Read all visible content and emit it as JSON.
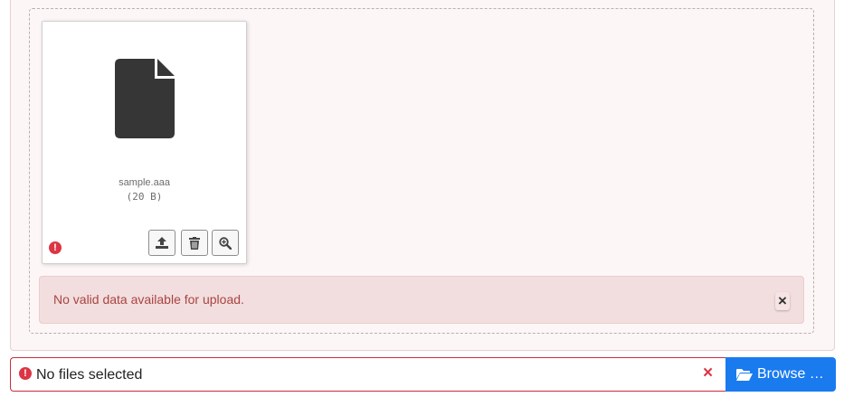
{
  "preview": {
    "file": {
      "name": "sample.aaa",
      "size": "(20 B)",
      "icon": "file-icon",
      "status": "error"
    },
    "actions": [
      {
        "name": "upload-file-button",
        "icon": "upload-icon"
      },
      {
        "name": "remove-file-button",
        "icon": "trash-icon"
      },
      {
        "name": "zoom-file-button",
        "icon": "zoom-in-icon"
      }
    ],
    "error_marker": "!"
  },
  "alert": {
    "message": "No valid data available for upload.",
    "close_label": "×"
  },
  "caption": {
    "error_marker": "!",
    "text": "No files selected",
    "clear_label": "×"
  },
  "browse": {
    "label": "Browse …",
    "icon": "folder-open-icon"
  },
  "colors": {
    "error": "#dc3545",
    "alert_bg": "#f2dede",
    "alert_text": "#a94442",
    "primary": "#1a7bef"
  }
}
